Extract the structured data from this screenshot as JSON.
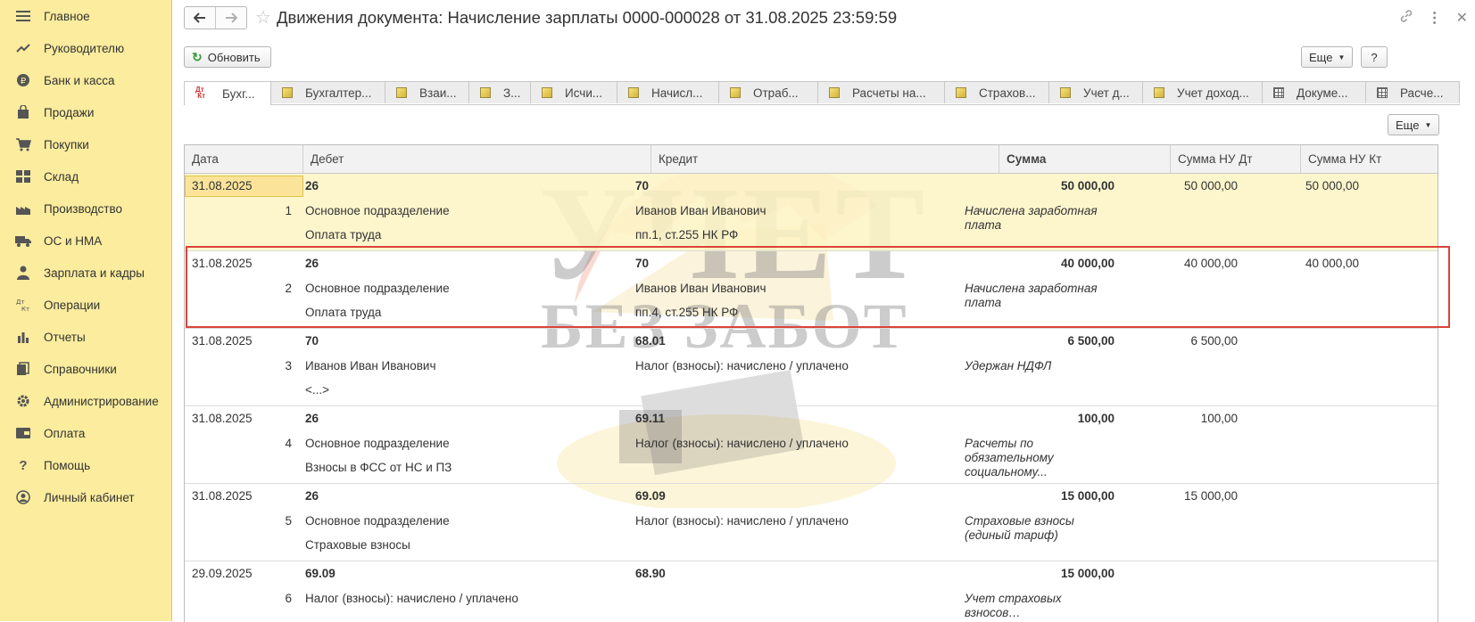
{
  "sidebar": {
    "items": [
      {
        "label": "Главное",
        "icon": "menu-icon"
      },
      {
        "label": "Руководителю",
        "icon": "trend-icon"
      },
      {
        "label": "Банк и касса",
        "icon": "ruble-icon"
      },
      {
        "label": "Продажи",
        "icon": "shopping-bag-icon"
      },
      {
        "label": "Покупки",
        "icon": "cart-icon"
      },
      {
        "label": "Склад",
        "icon": "warehouse-icon"
      },
      {
        "label": "Производство",
        "icon": "factory-icon"
      },
      {
        "label": "ОС и НМА",
        "icon": "truck-icon"
      },
      {
        "label": "Зарплата и кадры",
        "icon": "person-icon"
      },
      {
        "label": "Операции",
        "icon": "dt-kt-icon"
      },
      {
        "label": "Отчеты",
        "icon": "bar-chart-icon"
      },
      {
        "label": "Справочники",
        "icon": "books-icon"
      },
      {
        "label": "Администрирование",
        "icon": "gear-icon"
      },
      {
        "label": "Оплата",
        "icon": "wallet-icon"
      },
      {
        "label": "Помощь",
        "icon": "question-icon"
      },
      {
        "label": "Личный кабинет",
        "icon": "account-icon"
      }
    ]
  },
  "header": {
    "title": "Движения документа: Начисление зарплаты 0000-000028 от 31.08.2025 23:59:59"
  },
  "toolbar": {
    "refresh_label": "Обновить",
    "more_label": "Еще",
    "help_label": "?",
    "grid_more_label": "Еще"
  },
  "tabs": [
    {
      "label": "Бухг...",
      "icon": "dt-kt-icon"
    },
    {
      "label": "Бухгалтер...",
      "icon": "register-icon"
    },
    {
      "label": "Взаи...",
      "icon": "register-icon"
    },
    {
      "label": "З...",
      "icon": "register-icon"
    },
    {
      "label": "Исчи...",
      "icon": "register-icon"
    },
    {
      "label": "Начисл...",
      "icon": "register-icon"
    },
    {
      "label": "Отраб...",
      "icon": "register-icon"
    },
    {
      "label": "Расчеты на...",
      "icon": "register-icon"
    },
    {
      "label": "Страхов...",
      "icon": "register-icon"
    },
    {
      "label": "Учет д...",
      "icon": "register-icon"
    },
    {
      "label": "Учет доход...",
      "icon": "register-icon"
    },
    {
      "label": "Докуме...",
      "icon": "table-icon"
    },
    {
      "label": "Расче...",
      "icon": "table-icon"
    }
  ],
  "table": {
    "columns": [
      "Дата",
      "Дебет",
      "Кредит",
      "Сумма",
      "Сумма НУ Дт",
      "Сумма НУ Кт"
    ],
    "rows": [
      {
        "date": "31.08.2025",
        "num": "1",
        "debit": "26",
        "debit_sub1": "Основное подразделение",
        "debit_sub2": "Оплата труда",
        "credit": "70",
        "credit_sub1": "Иванов Иван Иванович",
        "credit_sub2": "пп.1, ст.255 НК РФ",
        "sum": "50 000,00",
        "content": "Начислена заработная плата",
        "nu_dt": "50 000,00",
        "nu_kt": "50 000,00"
      },
      {
        "date": "31.08.2025",
        "num": "2",
        "debit": "26",
        "debit_sub1": "Основное подразделение",
        "debit_sub2": "Оплата труда",
        "credit": "70",
        "credit_sub1": "Иванов Иван Иванович",
        "credit_sub2": "пп.4, ст.255 НК РФ",
        "sum": "40 000,00",
        "content": "Начислена заработная плата",
        "nu_dt": "40 000,00",
        "nu_kt": "40 000,00"
      },
      {
        "date": "31.08.2025",
        "num": "3",
        "debit": "70",
        "debit_sub1": "Иванов Иван Иванович",
        "debit_sub2": "<...>",
        "credit": "68.01",
        "credit_sub1": "Налог (взносы): начислено / уплачено",
        "credit_sub2": "",
        "sum": "6 500,00",
        "content": "Удержан НДФЛ",
        "nu_dt": "6 500,00",
        "nu_kt": ""
      },
      {
        "date": "31.08.2025",
        "num": "4",
        "debit": "26",
        "debit_sub1": "Основное подразделение",
        "debit_sub2": "Взносы в ФСС от НС и ПЗ",
        "credit": "69.11",
        "credit_sub1": "Налог (взносы): начислено / уплачено",
        "credit_sub2": "",
        "sum": "100,00",
        "content": "Расчеты по обязательному социальному...",
        "nu_dt": "100,00",
        "nu_kt": ""
      },
      {
        "date": "31.08.2025",
        "num": "5",
        "debit": "26",
        "debit_sub1": "Основное подразделение",
        "debit_sub2": "Страховые взносы",
        "credit": "69.09",
        "credit_sub1": "Налог (взносы): начислено / уплачено",
        "credit_sub2": "",
        "sum": "15 000,00",
        "content": "Страховые взносы (единый тариф)",
        "nu_dt": "15 000,00",
        "nu_kt": ""
      },
      {
        "date": "29.09.2025",
        "num": "6",
        "debit": "69.09",
        "debit_sub1": "Налог (взносы): начислено / уплачено",
        "debit_sub2": "",
        "credit": "68.90",
        "credit_sub1": "",
        "credit_sub2": "",
        "sum": "15 000,00",
        "content": "Учет страховых взносов…",
        "nu_dt": "",
        "nu_kt": ""
      }
    ]
  },
  "watermark": {
    "line1": "УЧЕТ",
    "line2": "БЕЗ ЗАБОТ"
  },
  "colors": {
    "sidebar_bg": "#fbec9e",
    "selected_row": "#fdf4c4",
    "highlight_frame": "#d9443a"
  }
}
